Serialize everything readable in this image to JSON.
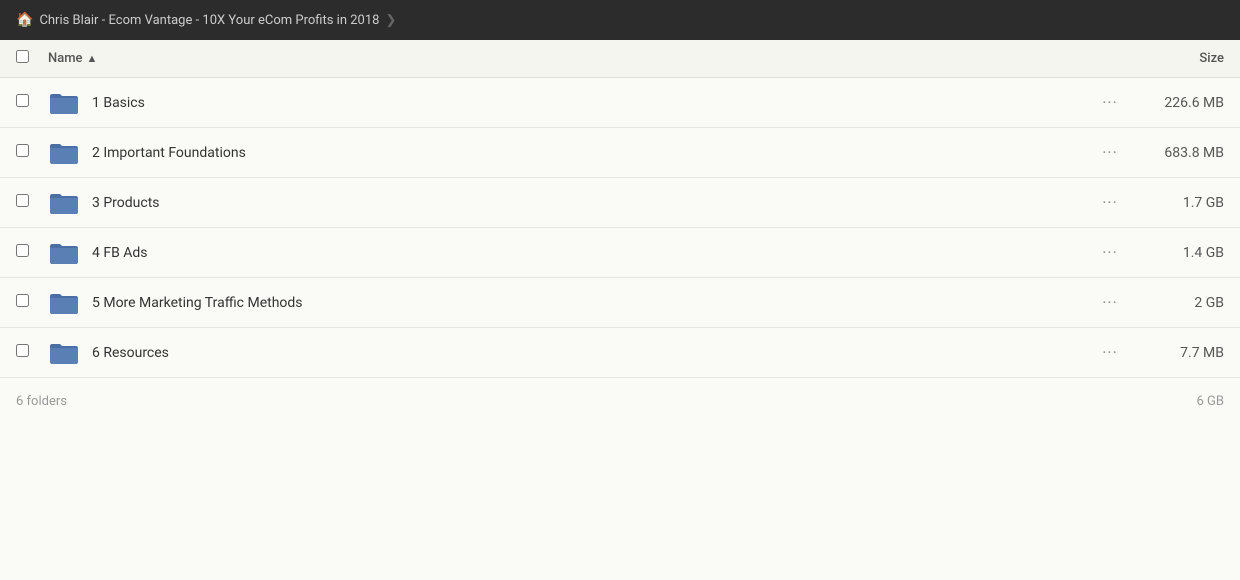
{
  "topbar": {
    "home_icon": "🏠",
    "title": "Chris Blair - Ecom Vantage - 10X Your eCom Profits in 2018",
    "arrow": "❯"
  },
  "table": {
    "header": {
      "name_label": "Name",
      "sort_indicator": "▲",
      "size_label": "Size"
    },
    "rows": [
      {
        "id": 1,
        "name": "1 Basics",
        "size": "226.6 MB"
      },
      {
        "id": 2,
        "name": "2 Important Foundations",
        "size": "683.8 MB"
      },
      {
        "id": 3,
        "name": "3 Products",
        "size": "1.7 GB"
      },
      {
        "id": 4,
        "name": "4 FB Ads",
        "size": "1.4 GB"
      },
      {
        "id": 5,
        "name": "5 More Marketing Traffic Methods",
        "size": "2 GB"
      },
      {
        "id": 6,
        "name": "6 Resources",
        "size": "7.7 MB"
      }
    ],
    "footer": {
      "summary": "6 folders",
      "total_size": "6 GB"
    }
  },
  "colors": {
    "folder_blue": "#4a6fa5",
    "folder_blue_dark": "#3a5a8a"
  }
}
